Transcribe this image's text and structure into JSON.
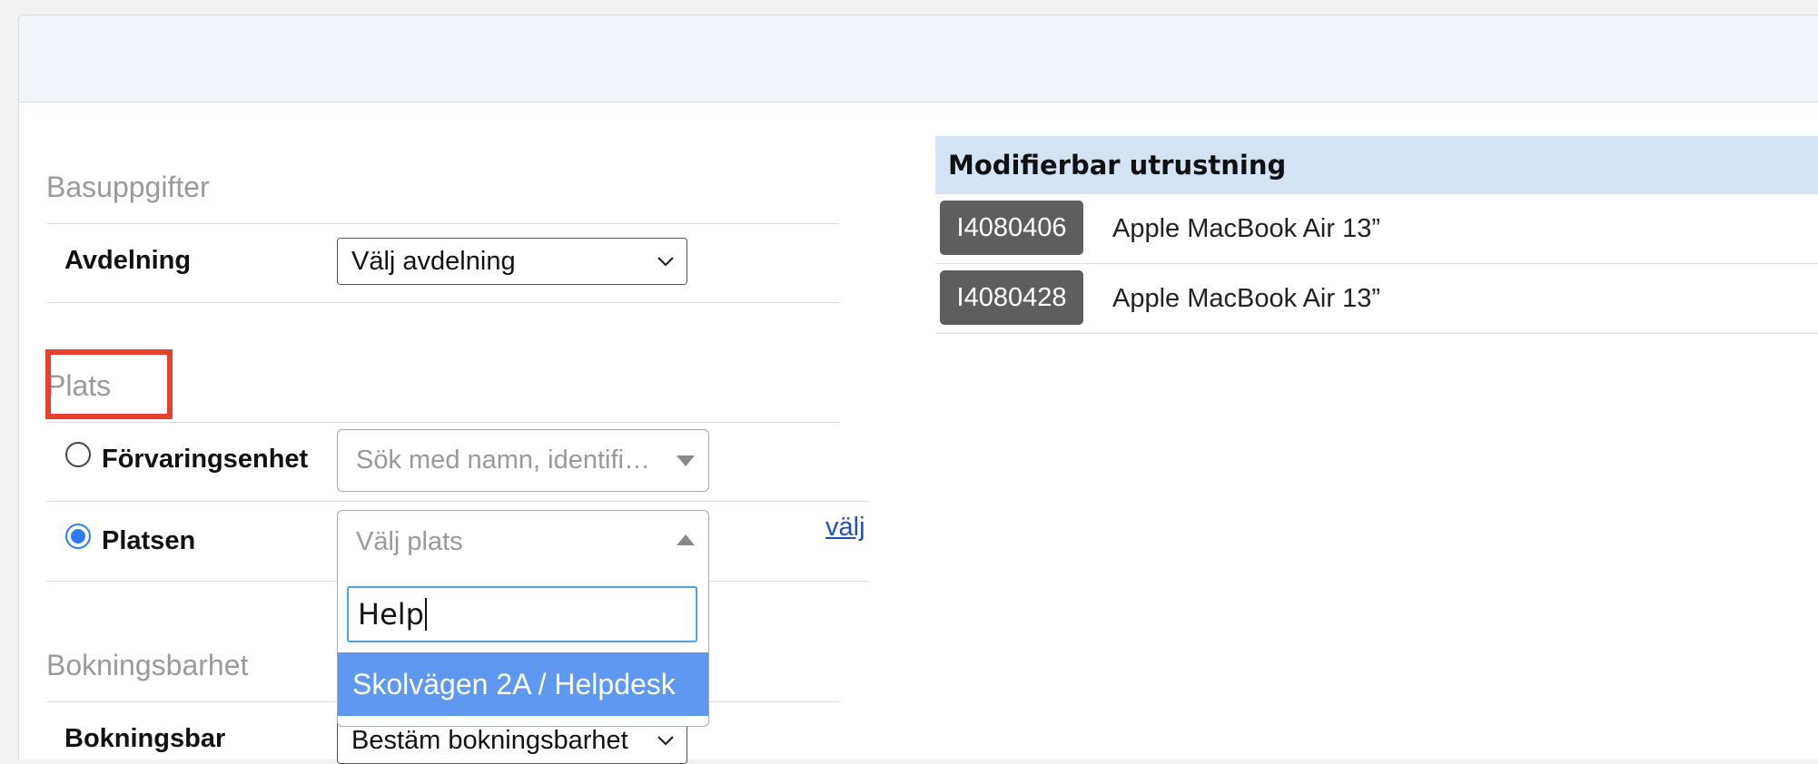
{
  "sections": {
    "basic": "Basuppgifter",
    "place": "Plats",
    "booking": "Bokningsbarhet"
  },
  "fields": {
    "department": {
      "label": "Avdelning",
      "value": "Välj avdelning"
    },
    "storage_unit": {
      "label": "Förvaringsenhet",
      "placeholder": "Sök med namn, identifi…",
      "selected": false
    },
    "location": {
      "label": "Platsen",
      "placeholder": "Välj plats",
      "selected": true,
      "link": "välj"
    },
    "bookable": {
      "label": "Bokningsbar",
      "value": "Bestäm bokningsbarhet"
    }
  },
  "dropdown": {
    "search_value": "Help",
    "options": [
      "Skolvägen 2A / Helpdesk"
    ]
  },
  "equipment": {
    "header": "Modifierbar utrustning",
    "rows": [
      {
        "id": "I4080406",
        "name": "Apple MacBook Air 13”"
      },
      {
        "id": "I4080428",
        "name": "Apple MacBook Air 13”"
      }
    ]
  },
  "colors": {
    "highlight": "#e84030",
    "accent": "#2f7bf5",
    "option_highlight": "#5f98f0",
    "table_header": "#d5e4f5"
  },
  "icons": {
    "department_select": "chevron-down-icon",
    "storage_select": "triangle-down-icon",
    "location_select": "triangle-up-icon"
  }
}
